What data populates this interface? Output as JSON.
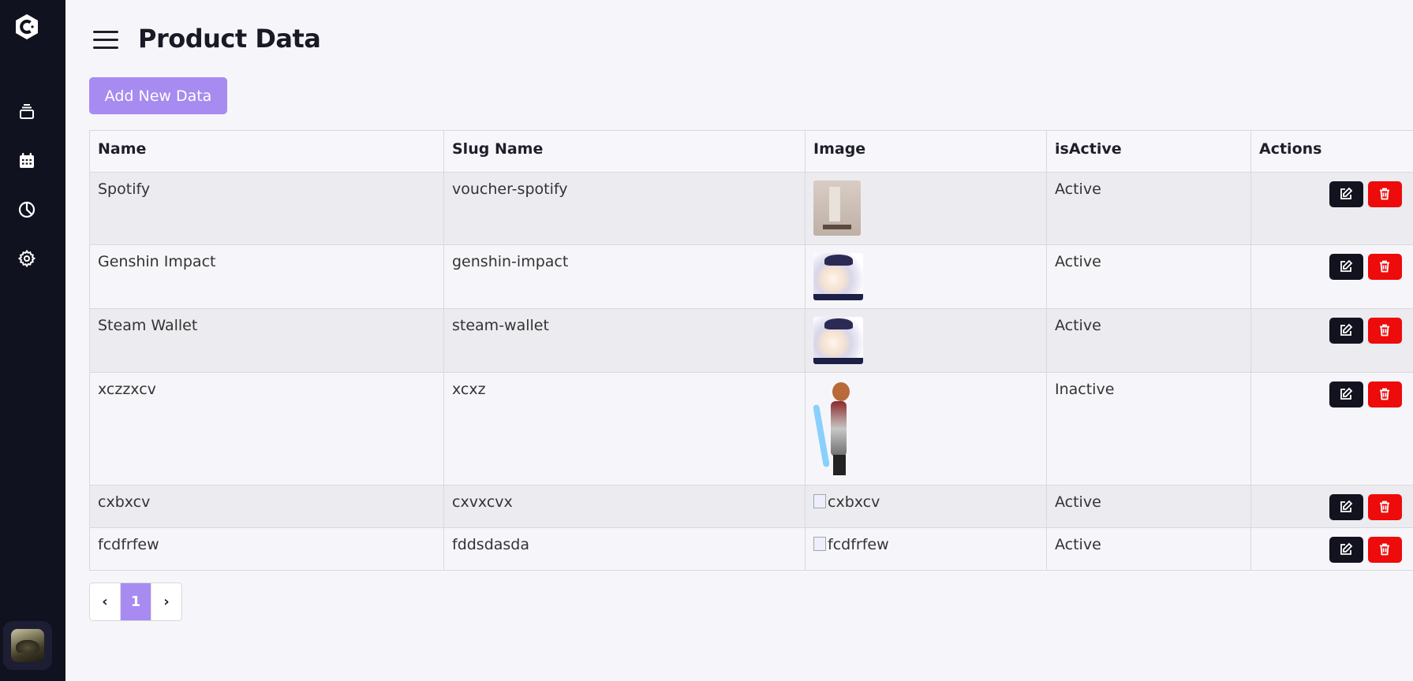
{
  "header": {
    "title": "Product Data"
  },
  "toolbar": {
    "add_label": "Add New Data"
  },
  "colors": {
    "accent": "#a78bf0",
    "sidebar": "#11121f",
    "delete": "#ee0b0b",
    "edit": "#12131f"
  },
  "sidebar": {
    "items": [
      {
        "icon": "stack-icon"
      },
      {
        "icon": "calendar-icon"
      },
      {
        "icon": "pie-chart-icon"
      },
      {
        "icon": "gear-icon"
      }
    ]
  },
  "table": {
    "columns": [
      "Name",
      "Slug Name",
      "Image",
      "isActive",
      "Actions"
    ],
    "rows": [
      {
        "name": "Spotify",
        "slug": "voucher-spotify",
        "image": "box-photo",
        "status": "Active"
      },
      {
        "name": "Genshin Impact",
        "slug": "genshin-impact",
        "image": "anime-portrait",
        "status": "Active"
      },
      {
        "name": "Steam Wallet",
        "slug": "steam-wallet",
        "image": "anime-portrait",
        "status": "Active"
      },
      {
        "name": "xczzxcv",
        "slug": "xcxz",
        "image": "character-figure",
        "status": "Inactive"
      },
      {
        "name": "cxbxcv",
        "slug": "cxvxcvx",
        "image_alt": "cxbxcv",
        "status": "Active"
      },
      {
        "name": "fcdfrfew",
        "slug": "fddsdasda",
        "image_alt": "fcdfrfew",
        "status": "Active"
      }
    ]
  },
  "pagination": {
    "prev": "‹",
    "current": "1",
    "next": "›"
  }
}
